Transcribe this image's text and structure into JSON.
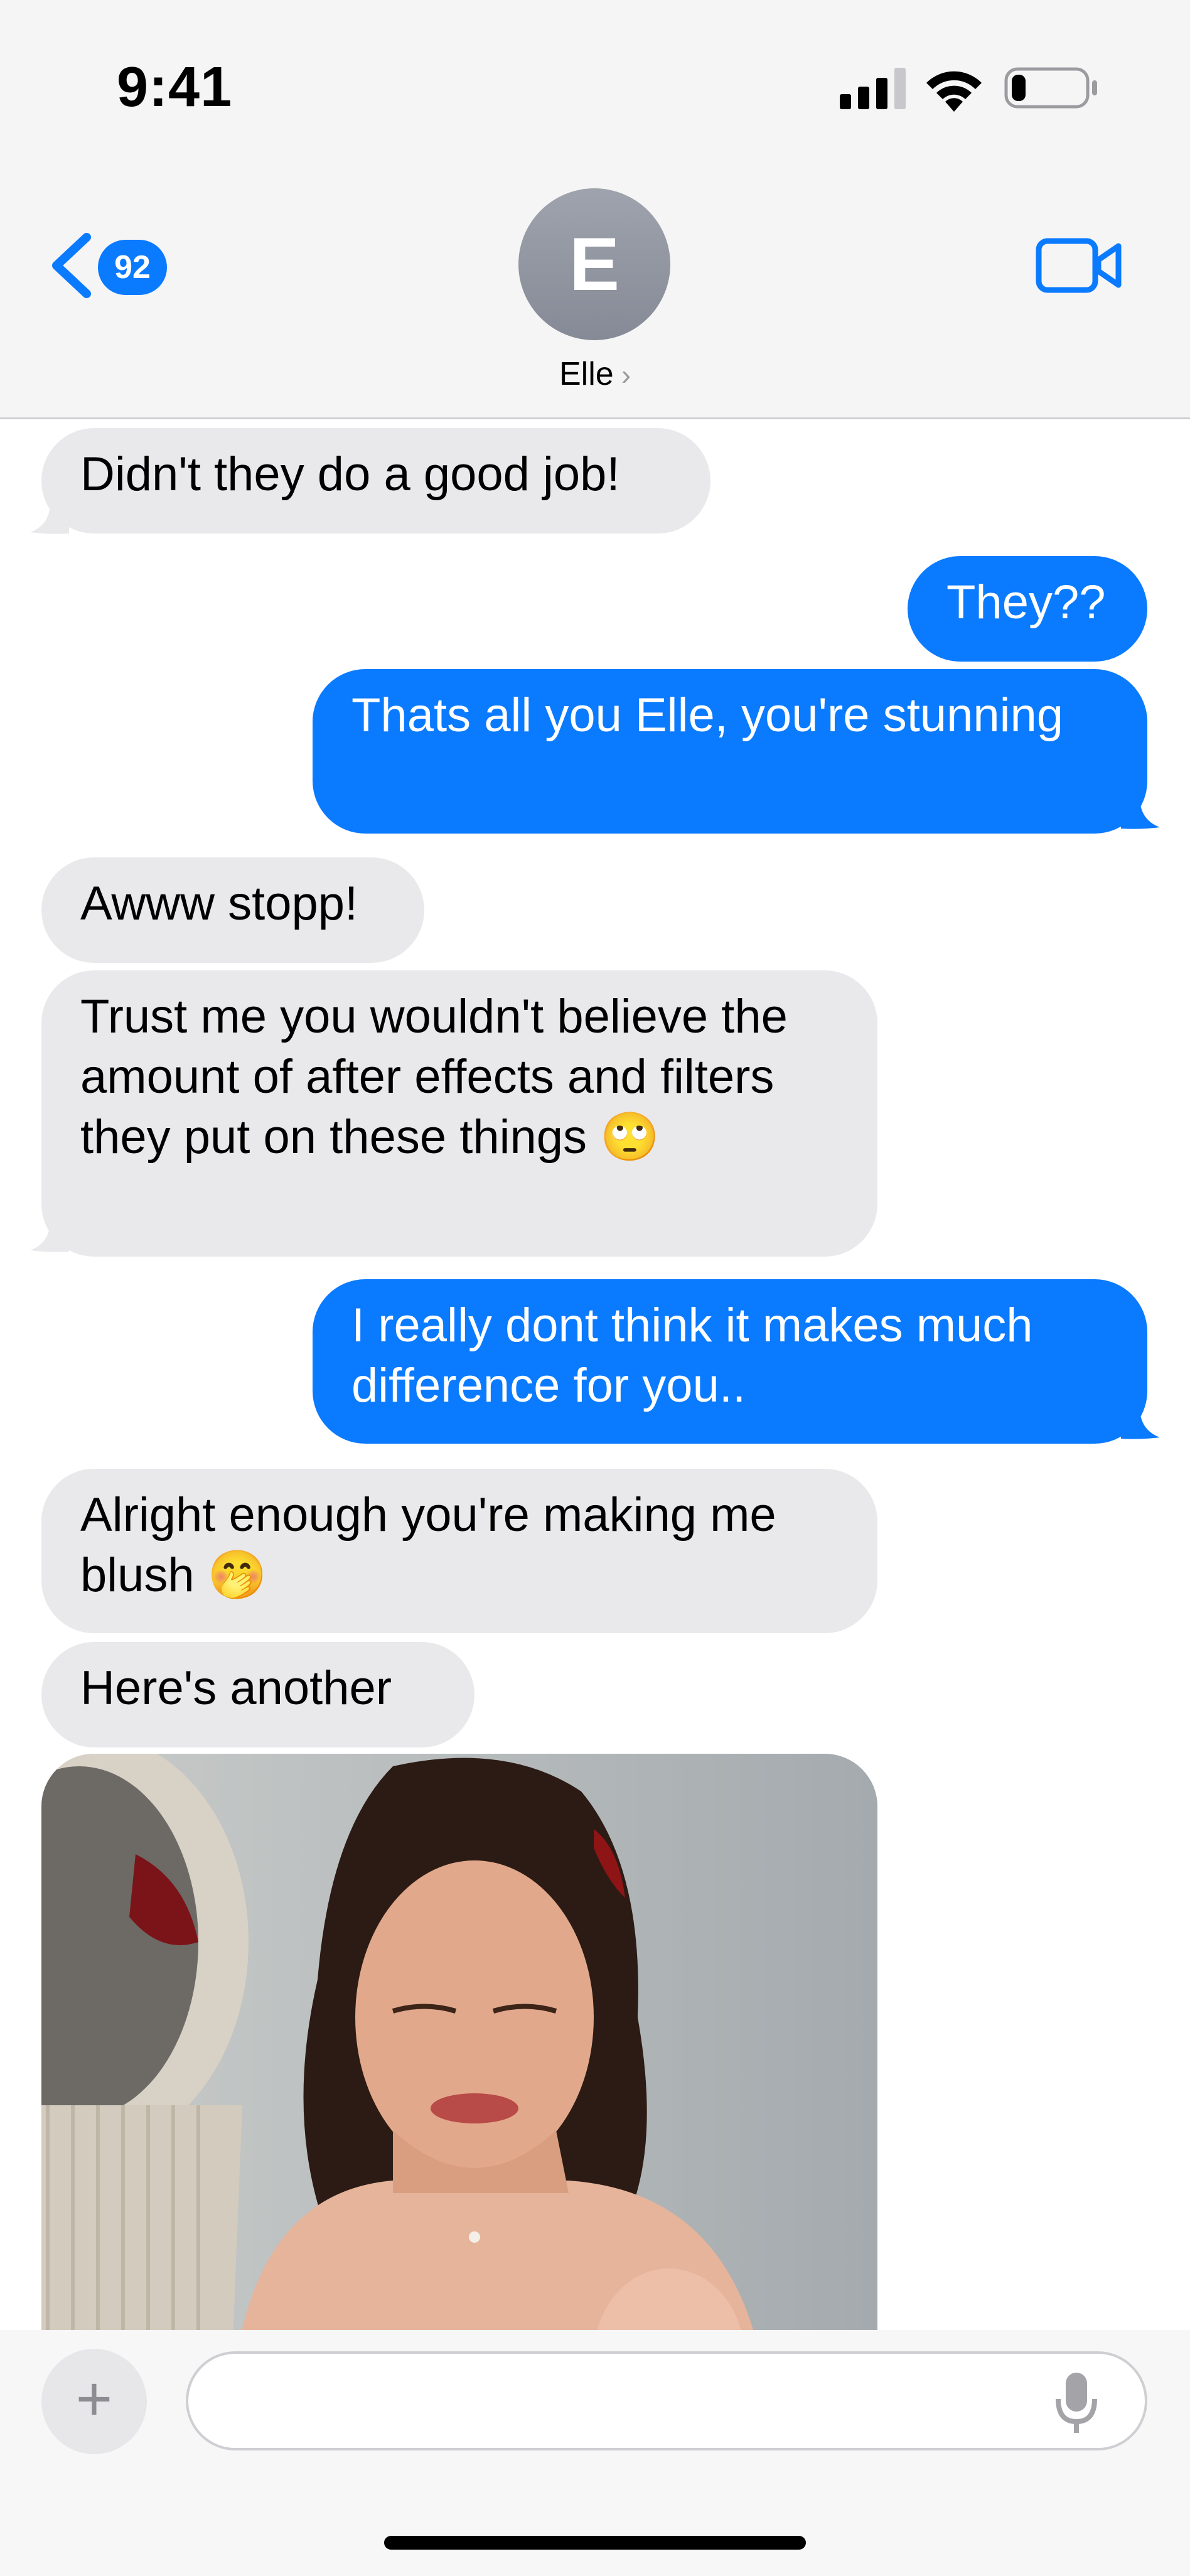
{
  "status_bar": {
    "time": "9:41",
    "signal_icon": "signal-bars-icon",
    "wifi_icon": "wifi-icon",
    "battery_icon": "battery-icon",
    "battery_level": 0.2
  },
  "header": {
    "back_badge": "92",
    "avatar_initial": "E",
    "contact_name": "Elle",
    "contact_chevron": "›",
    "video_icon": "video-camera-icon"
  },
  "messages": [
    {
      "from": "them",
      "text": "Didn't they do a good job!"
    },
    {
      "from": "me",
      "text": "They??"
    },
    {
      "from": "me",
      "text": "Thats all you Elle, you're stunning"
    },
    {
      "from": "them",
      "text": "Awww stopp!"
    },
    {
      "from": "them",
      "text": "Trust me you wouldn't believe the amount of after effects and filters they put on these things 🙄"
    },
    {
      "from": "me",
      "text": "I really dont think it makes much difference for you.."
    },
    {
      "from": "them",
      "text": "Alright enough you're making me blush 🤭"
    },
    {
      "from": "them",
      "text": "Here's another"
    }
  ],
  "composer": {
    "plus_label": "+",
    "input_value": "",
    "mic_icon": "microphone-icon"
  },
  "colors": {
    "accent": "#0a7aff",
    "incoming_bubble": "#e9e9eb",
    "header_bg": "#f5f5f5"
  }
}
